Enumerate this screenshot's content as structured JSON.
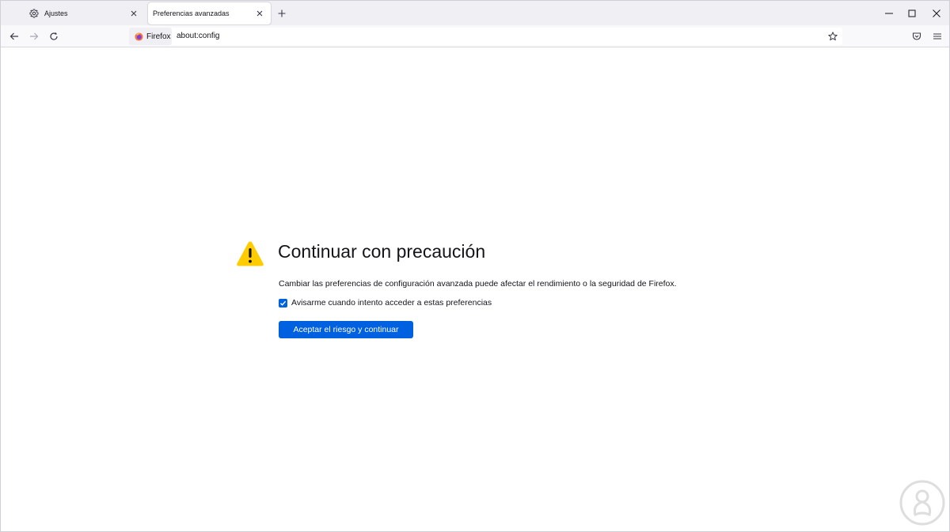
{
  "tabs": [
    {
      "label": "Ajustes",
      "icon": "gear-icon",
      "active": false
    },
    {
      "label": "Preferencias avanzadas",
      "active": true
    }
  ],
  "navbar": {
    "identity_label": "Firefox",
    "url": "about:config"
  },
  "warning": {
    "title": "Continuar con precaución",
    "description": "Cambiar las preferencias de configuración avanzada puede afectar el rendimiento o la seguridad de Firefox.",
    "checkbox_label": "Avisarme cuando intento acceder a estas preferencias",
    "checkbox_checked": true,
    "accept_button": "Aceptar el riesgo y continuar"
  },
  "colors": {
    "accent": "#0061e0",
    "warning": "#ffcc00"
  }
}
